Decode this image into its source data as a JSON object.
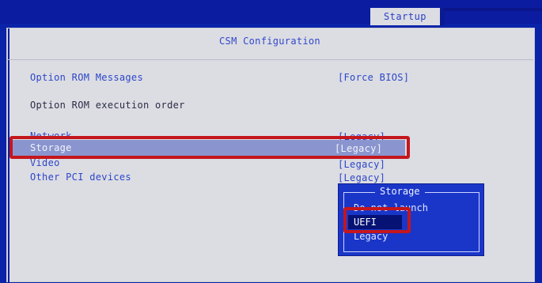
{
  "header": {
    "active_tab": "Startup"
  },
  "section": {
    "title": "CSM Configuration"
  },
  "settings": {
    "option_rom_messages": {
      "label": "Option ROM Messages",
      "value": "[Force BIOS]"
    },
    "execution_order_heading": "Option ROM execution order",
    "network": {
      "label": "Network",
      "value": "[Legacy]"
    },
    "storage": {
      "label": "Storage",
      "value": "[Legacy]"
    },
    "video": {
      "label": "Video",
      "value": "[Legacy]"
    },
    "other_pci": {
      "label": "Other PCI devices",
      "value": "[Legacy]"
    }
  },
  "popup": {
    "title": "Storage",
    "options": [
      "Do not launch",
      "UEFI",
      "Legacy"
    ],
    "selected": "UEFI"
  },
  "colors": {
    "bios_blue": "#0a23a8",
    "panel_gray": "#dcdde3",
    "highlight": "#c4161c"
  }
}
